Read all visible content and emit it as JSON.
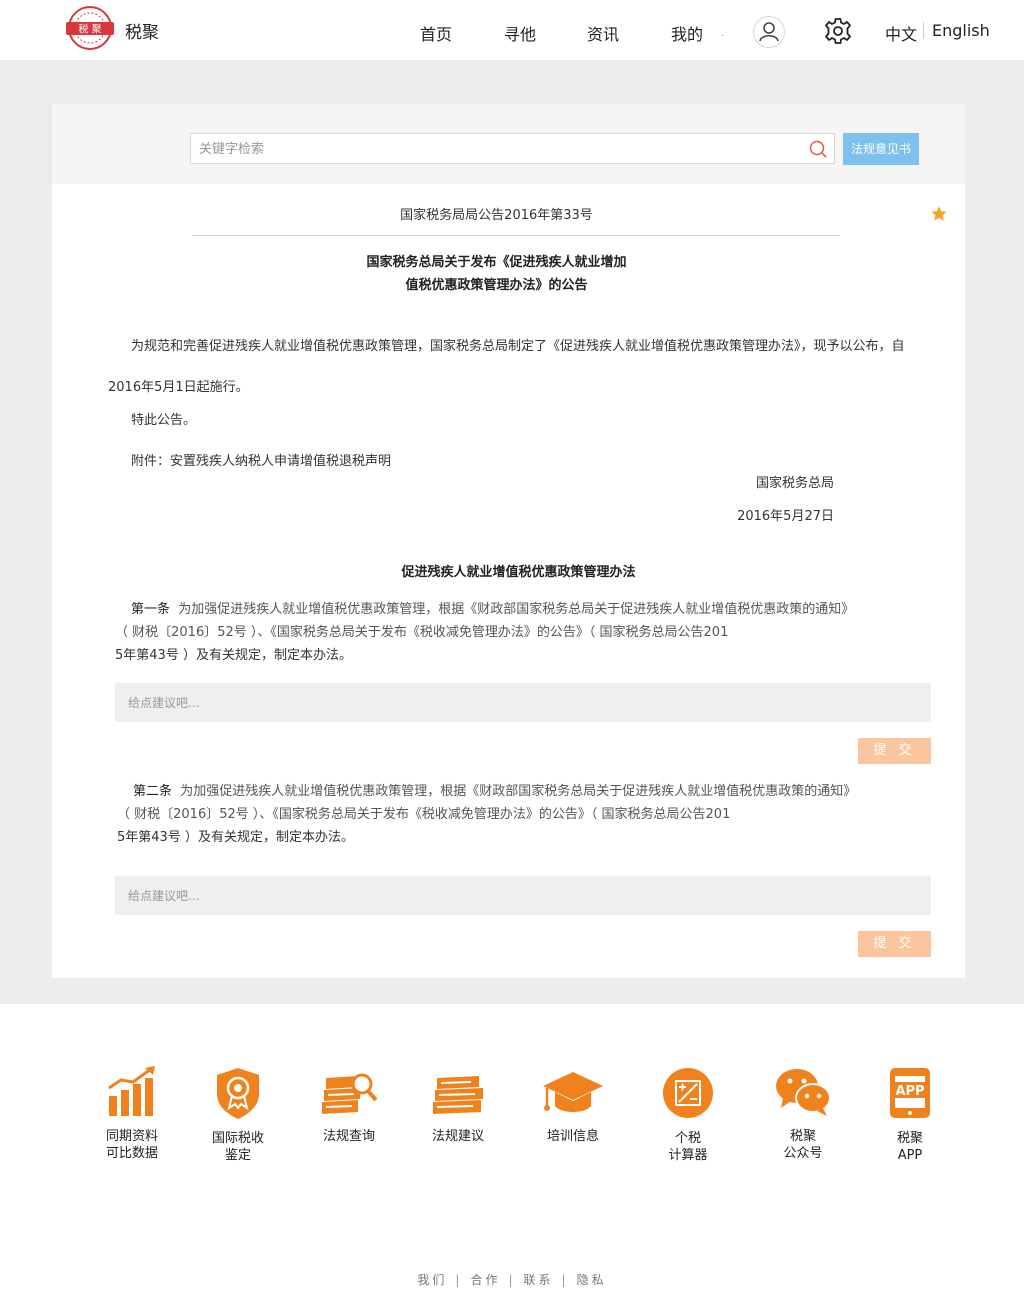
{
  "header": {
    "logo_text": "税聚",
    "nav": [
      "首页",
      "寻他",
      "资讯",
      "我的"
    ],
    "nav_dot": ".",
    "lang_cn": "中文",
    "lang_en": "English"
  },
  "search": {
    "placeholder": "关键字检索",
    "opinion_button": "法规意见书"
  },
  "doc": {
    "number": "国家税务局局公告2016年第33号",
    "title_line1": "国家税务总局关于发布《促进残疾人就业增加",
    "title_line2": "值税优惠政策管理办法》的公告",
    "body": "为规范和完善促进残疾人就业增值税优惠政策管理，国家税务总局制定了《促进残疾人就业增值税优惠政策管理办法》，现予以公布，自2016年5月1日起施行。",
    "closing": "特此公告。",
    "attachment": "附件：安置残疾人纳税人申请增值税退税声明",
    "issuer": "国家税务总局",
    "date": "2016年5月27日",
    "sub_title": "促进残疾人就业增值税优惠政策管理办法"
  },
  "articles": [
    {
      "lead": "第一条",
      "line1": "为加强促进残疾人就业增值税优惠政策管理，根据《财政部国家税务总局关于促进残疾人就业增值税优惠政策的通知》",
      "line2": "（ 财税〔2016〕52号 ）、《国家税务总局关于发布《税收减免管理办法》的公告》（ 国家税务总局公告201",
      "line3": "5年第43号 ）及有关规定，制定本办法。",
      "suggest_placeholder": "给点建议吧...",
      "submit": "提 交"
    },
    {
      "lead": "第二条",
      "line1": "为加强促进残疾人就业增值税优惠政策管理，根据《财政部国家税务总局关于促进残疾人就业增值税优惠政策的通知》",
      "line2": "（ 财税〔2016〕52号 ）、《国家税务总局关于发布《税收减免管理办法》的公告》（ 国家税务总局公告201",
      "line3": "5年第43号 ）及有关规定，制定本办法。",
      "suggest_placeholder": "给点建议吧...",
      "submit": "提 交"
    }
  ],
  "services": [
    {
      "label": "同期资料\n可比数据",
      "icon": "bar-chart-icon"
    },
    {
      "label": "国际税收\n鉴定",
      "icon": "badge-icon"
    },
    {
      "label": "法规查询",
      "icon": "books-search-icon"
    },
    {
      "label": "法规建议",
      "icon": "books-icon"
    },
    {
      "label": "培训信息",
      "icon": "graduation-cap-icon"
    },
    {
      "label": "个税\n计算器",
      "icon": "calculator-icon"
    },
    {
      "label": "税聚\n公众号",
      "icon": "wechat-icon"
    },
    {
      "label": "税聚\nAPP",
      "icon": "phone-app-icon"
    }
  ],
  "app_icon_text": "APP",
  "footer": [
    "我们",
    "合作",
    "联系",
    "隐私"
  ],
  "colors": {
    "accent_orange": "#f0821e",
    "button_blue": "#7ec0ee",
    "submit_orange": "#fbc59d",
    "logo_red": "#d9363e",
    "star": "#f5a623"
  }
}
